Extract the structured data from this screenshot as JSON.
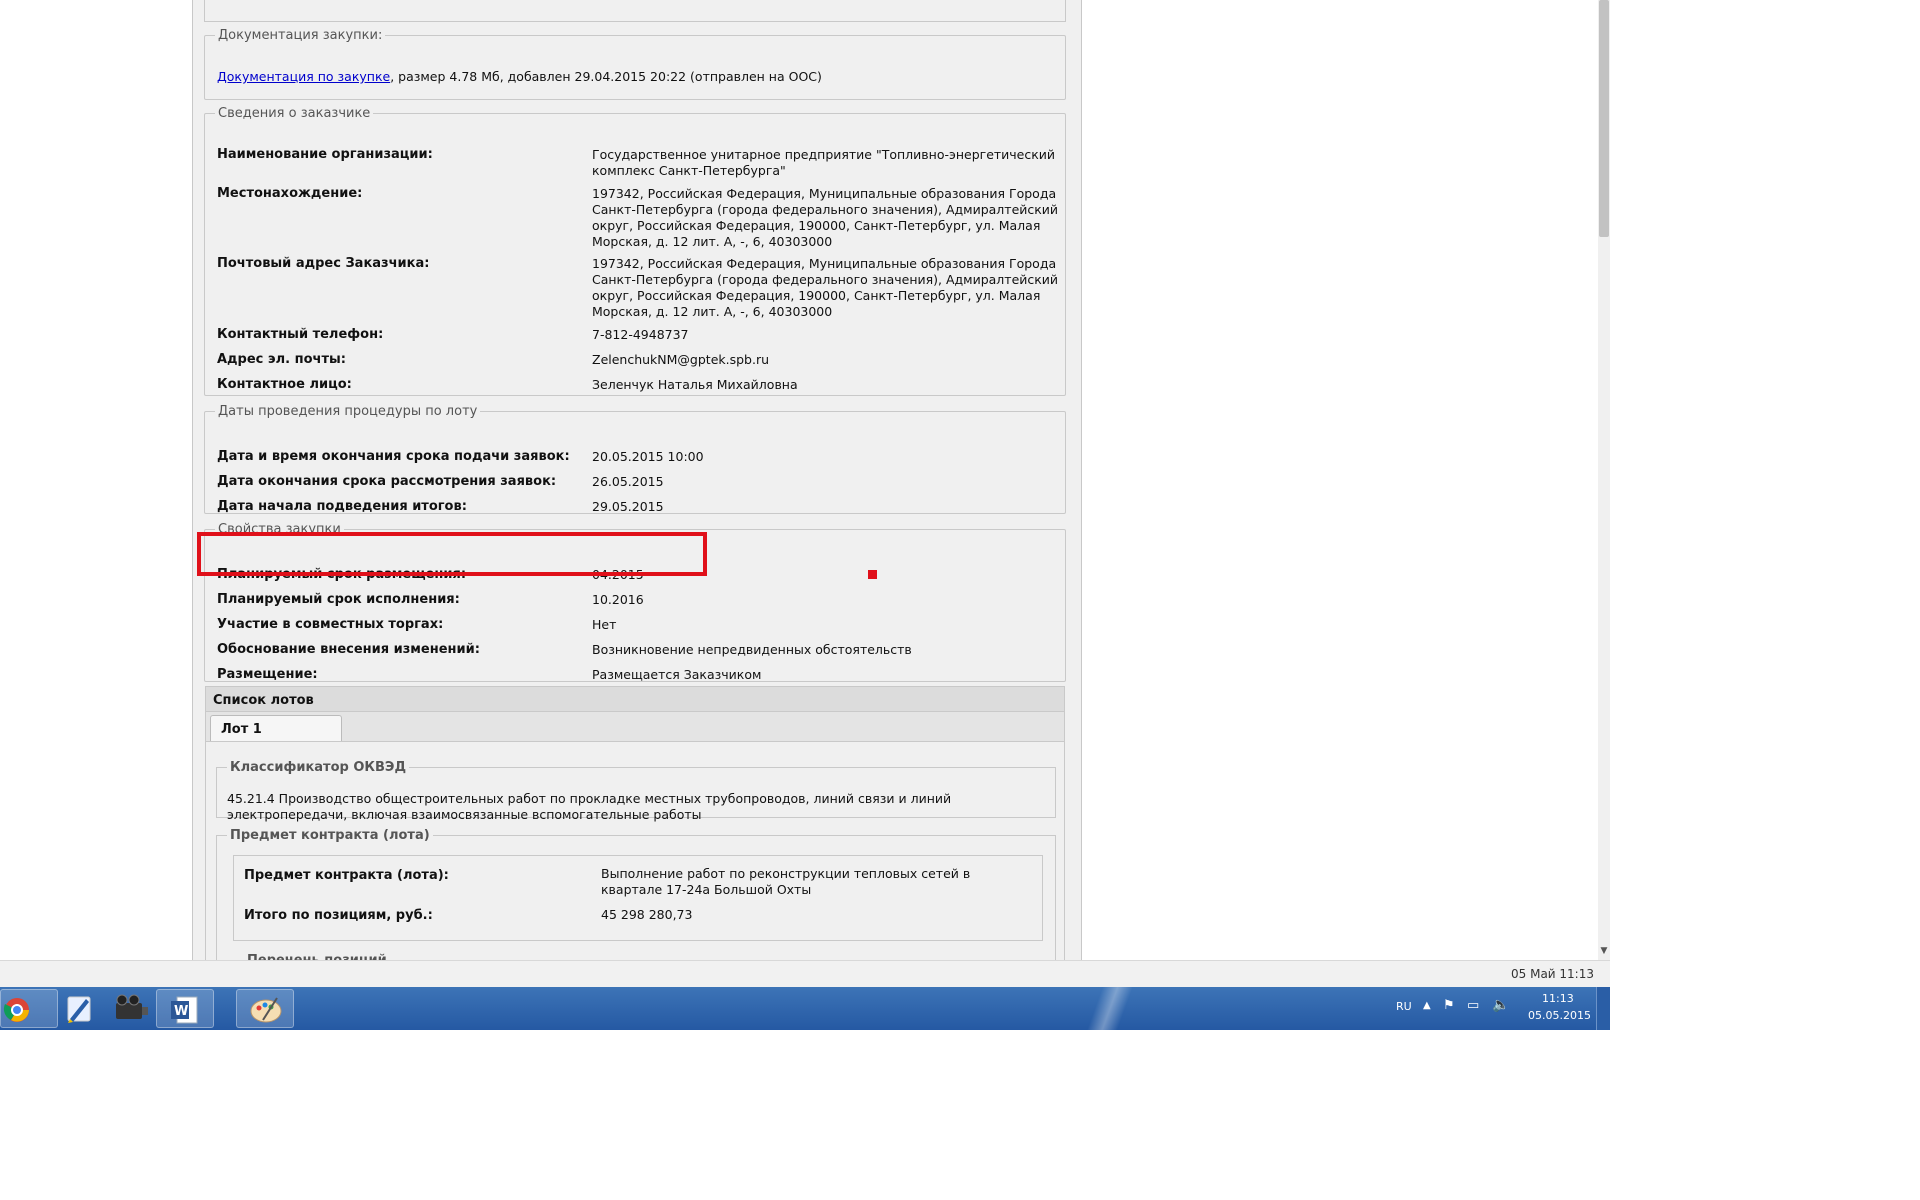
{
  "documentation": {
    "legend": "Документация закупки:",
    "link_text": "Документация по закупке",
    "info": ", размер 4.78 Мб, добавлен 29.04.2015 20:22 (отправлен на ООС)"
  },
  "customer": {
    "legend": "Сведения о заказчике",
    "rows": [
      {
        "label": "Наименование организации:",
        "value": "Государственное унитарное предприятие \"Топливно-энергетический комплекс Санкт-Петербурга\""
      },
      {
        "label": "Местонахождение:",
        "value": "197342, Российская Федерация, Муниципальные образования Города Санкт-Петербурга (города федерального значения), Адмиралтейский округ, Российская Федерация, 190000, Санкт-Петербург, ул. Малая Морская, д. 12 лит. А, -, 6, 40303000"
      },
      {
        "label": "Почтовый адрес Заказчика:",
        "value": "197342, Российская Федерация, Муниципальные образования Города Санкт-Петербурга (города федерального значения), Адмиралтейский округ, Российская Федерация, 190000, Санкт-Петербург, ул. Малая Морская, д. 12 лит. А, -, 6, 40303000"
      },
      {
        "label": "Контактный телефон:",
        "value": "7-812-4948737"
      },
      {
        "label": "Адрес эл. почты:",
        "value": "ZelenchukNM@gptek.spb.ru"
      },
      {
        "label": "Контактное лицо:",
        "value": "Зеленчук Наталья Михайловна"
      }
    ]
  },
  "dates": {
    "legend": "Даты проведения процедуры по лоту",
    "rows": [
      {
        "label": "Дата и время окончания срока подачи заявок:",
        "value": "20.05.2015 10:00"
      },
      {
        "label": "Дата окончания срока рассмотрения заявок:",
        "value": "26.05.2015"
      },
      {
        "label": "Дата начала подведения итогов:",
        "value": "29.05.2015"
      }
    ]
  },
  "properties": {
    "legend": "Свойства закупки",
    "rows": [
      {
        "label": "Планируемый срок размещения:",
        "value": "04.2015"
      },
      {
        "label": "Планируемый срок исполнения:",
        "value": "10.2016"
      },
      {
        "label": "Участие в совместных торгах:",
        "value": "Нет"
      },
      {
        "label": "Обоснование внесения изменений:",
        "value": "Возникновение непредвиденных обстоятельств"
      },
      {
        "label": "Размещение:",
        "value": "Размещается Заказчиком"
      }
    ]
  },
  "lots": {
    "header": "Список лотов",
    "tab": "Лот 1",
    "okved_legend": "Классификатор ОКВЭД",
    "okved_text": "45.21.4 Производство общестроительных работ по прокладке местных трубопроводов, линий связи и линий электропередачи, включая взаимосвязанные вспомогательные работы",
    "subject_legend": "Предмет контракта (лота)",
    "subject_rows": [
      {
        "label": "Предмет контракта (лота):",
        "value": "Выполнение работ по реконструкции тепловых сетей в квартале 17-24а Большой Охты"
      },
      {
        "label": "Итого по позициям, руб.:",
        "value": "45 298 280,73"
      }
    ],
    "positions_legend": "Перечень позиций"
  },
  "statusbar": {
    "datetime": "05 Май 11:13"
  },
  "taskbar": {
    "apps": [
      "chrome-icon",
      "pen-tablet-icon",
      "film-projector-icon",
      "word-icon",
      "paint-icon"
    ],
    "lang": "RU",
    "time": "11:13",
    "date": "05.05.2015"
  },
  "colors": {
    "highlight": "#e0101a",
    "taskbar": "#2559a3",
    "link": "#0000cc"
  }
}
